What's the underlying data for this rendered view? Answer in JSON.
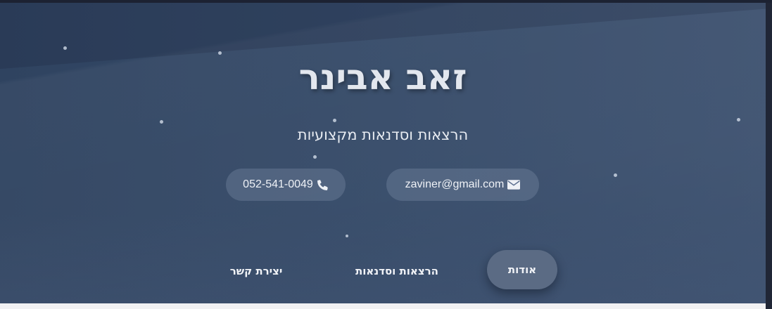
{
  "header": {
    "name": "זאב אבינר",
    "tagline": "הרצאות וסדנאות מקצועיות"
  },
  "contact": {
    "email": "zaviner@gmail.com",
    "phone": "052-541-0049",
    "email_icon": "envelope-icon",
    "phone_icon": "phone-icon"
  },
  "nav": {
    "items": [
      {
        "label": "אודות",
        "active": true
      },
      {
        "label": "הרצאות וסדנאות",
        "active": false
      },
      {
        "label": "יצירת קשר",
        "active": false
      }
    ]
  },
  "colors": {
    "background": "#354a68",
    "active_tab": "#5b6b84",
    "pill": "#6e809c",
    "text": "#eef1f6"
  }
}
